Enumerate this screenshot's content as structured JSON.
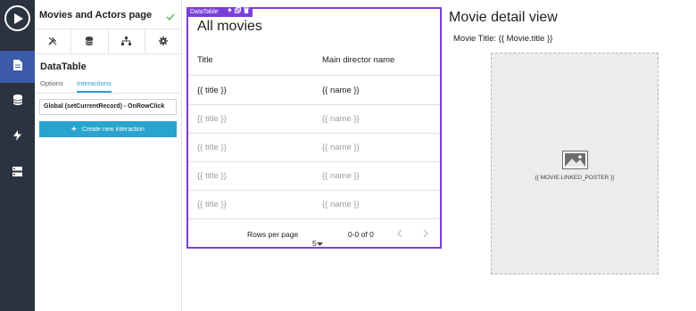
{
  "panel": {
    "title": "Movies and Actors page",
    "component_name": "DataTable",
    "tabs": [
      {
        "label": "Options",
        "active": false
      },
      {
        "label": "Interactions",
        "active": true
      }
    ],
    "interaction_field": "Global (setCurrentRecord) - OnRowClick",
    "create_button_label": "Create new interaction",
    "icon_toolbar": [
      "wrench-icon",
      "database-icon",
      "hierarchy-icon",
      "gear-icon"
    ]
  },
  "rail": {
    "items": [
      "play-icon",
      "page-icon",
      "database-icon",
      "lightning-icon",
      "server-icon"
    ],
    "active": "page-icon"
  },
  "datatable": {
    "badge_label": "DataTable",
    "heading": "All movies",
    "columns": [
      "Title",
      "Main director name"
    ],
    "rows": [
      [
        "{{ title }}",
        "{{ name }}"
      ],
      [
        "{{ title }}",
        "{{ name }}"
      ],
      [
        "{{ title }}",
        "{{ name }}"
      ],
      [
        "{{ title }}",
        "{{ name }}"
      ],
      [
        "{{ title }}",
        "{{ name }}"
      ]
    ],
    "footer": {
      "rows_per_page_label": "Rows per page",
      "rows_per_page_value": "5",
      "range_text": "0-0 of 0"
    }
  },
  "detail": {
    "title": "Movie detail view",
    "subtitle": "Movie Title: {{ Movie.title }}",
    "poster_caption": "{{ MOVIE.LINKED_POSTER }}"
  },
  "colors": {
    "rail_bg": "#2b3240",
    "rail_active": "#3b5aa8",
    "accent": "#29a3cf",
    "selection": "#7b3fd8",
    "check": "#5cb85c"
  }
}
